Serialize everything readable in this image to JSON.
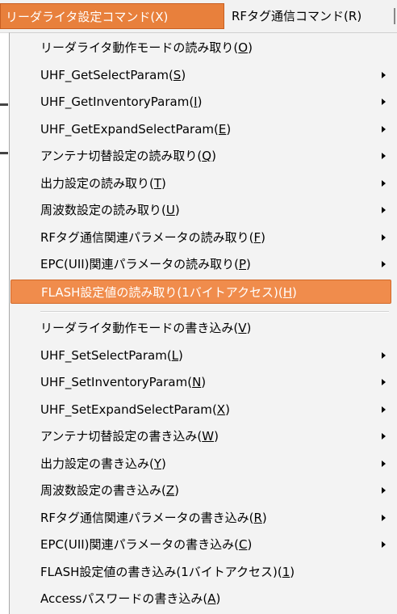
{
  "menubar": {
    "active_menu": "リーダライタ設定コマンド(X)",
    "next_menu": "RFタグ通信コマンド(R)"
  },
  "menu": {
    "read_items": [
      {
        "label": "リーダライタ動作モードの読み取り",
        "key": "O",
        "submenu": false
      },
      {
        "label": "UHF_GetSelectParam",
        "key": "S",
        "submenu": true
      },
      {
        "label": "UHF_GetInventoryParam",
        "key": "I",
        "submenu": true
      },
      {
        "label": "UHF_GetExpandSelectParam",
        "key": "E",
        "submenu": true
      },
      {
        "label": "アンテナ切替設定の読み取り",
        "key": "Q",
        "submenu": true
      },
      {
        "label": "出力設定の読み取り",
        "key": "T",
        "submenu": true
      },
      {
        "label": "周波数設定の読み取り",
        "key": "U",
        "submenu": true
      },
      {
        "label": "RFタグ通信関連パラメータの読み取り",
        "key": "F",
        "submenu": true
      },
      {
        "label": "EPC(UII)関連パラメータの読み取り",
        "key": "P",
        "submenu": true
      },
      {
        "label": "FLASH設定値の読み取り(1バイトアクセス)",
        "key": "H",
        "submenu": false,
        "highlighted": true
      }
    ],
    "write_items": [
      {
        "label": "リーダライタ動作モードの書き込み",
        "key": "V",
        "submenu": false
      },
      {
        "label": "UHF_SetSelectParam",
        "key": "L",
        "submenu": true
      },
      {
        "label": "UHF_SetInventoryParam",
        "key": "N",
        "submenu": true
      },
      {
        "label": "UHF_SetExpandSelectParam",
        "key": "X",
        "submenu": true
      },
      {
        "label": "アンテナ切替設定の書き込み",
        "key": "W",
        "submenu": true
      },
      {
        "label": "出力設定の書き込み",
        "key": "Y",
        "submenu": true
      },
      {
        "label": "周波数設定の書き込み",
        "key": "Z",
        "submenu": true
      },
      {
        "label": "RFタグ通信関連パラメータの書き込み",
        "key": "R",
        "submenu": true
      },
      {
        "label": "EPC(UII)関連パラメータの書き込み",
        "key": "C",
        "submenu": true
      },
      {
        "label": "FLASH設定値の書き込み(1バイトアクセス)",
        "key": "1",
        "submenu": false
      },
      {
        "label": "Accessパスワードの書き込み",
        "key": "A",
        "submenu": false
      }
    ]
  },
  "colors": {
    "highlight": "#f08c4c",
    "menubar_active": "#e8803c",
    "menu_background": "#f3f3f3"
  }
}
